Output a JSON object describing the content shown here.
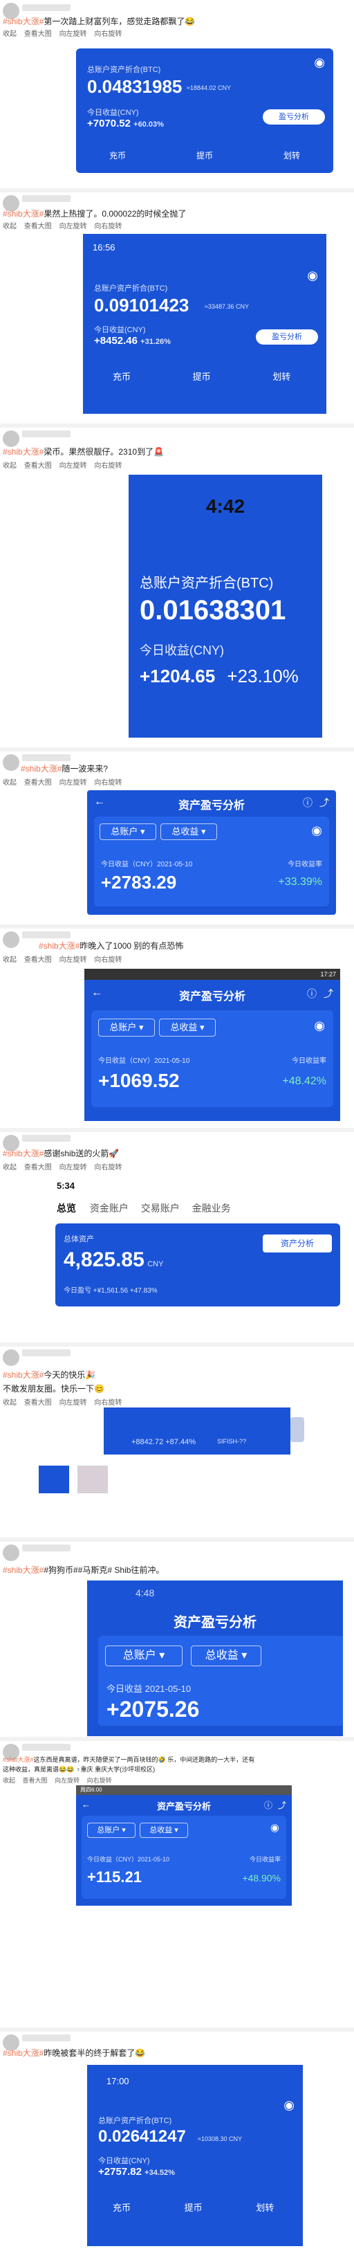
{
  "actions": {
    "favorite": "收起",
    "view_large": "查看大图",
    "rotate_left": "向左旋转",
    "rotate_right": "向右旋转"
  },
  "posts": [
    {
      "caption_tag": "#shib大涨#",
      "caption": "第一次踏上财富列车，感觉走路都飘了😂",
      "app": {
        "label": "总账户资产折合(BTC)",
        "value": "0.04831985",
        "sub": "≈18844.02 CNY",
        "income_label": "今日收益(CNY)",
        "income": "+7070.52",
        "pct": "+60.03%",
        "btn_profit": "盈亏分析",
        "b1": "充币",
        "b2": "提币",
        "b3": "划转"
      }
    },
    {
      "caption_tag": "#shib大涨#",
      "caption": "果然上热搜了。0.000022的时候全抛了",
      "app": {
        "time": "16:56",
        "label": "总账户资产折合(BTC)",
        "value": "0.09101423",
        "sub": "≈33487.36 CNY",
        "income_label": "今日收益(CNY)",
        "income": "+8452.46",
        "pct": "+31.26%",
        "btn_profit": "盈亏分析",
        "b1": "充币",
        "b2": "提币",
        "b3": "划转"
      }
    },
    {
      "caption_tag": "#shib大涨#",
      "caption": "梁币。果然很靓仔。2310到了🚨",
      "app": {
        "time": "4:42",
        "label": "总账户资产折合(BTC)",
        "value": "0.01638301",
        "income_label": "今日收益(CNY)",
        "income": "+1204.65",
        "pct": "+23.10%"
      }
    },
    {
      "caption_tag": "#shib大涨#",
      "caption": "随一波来来?",
      "app": {
        "title": "资产盈亏分析",
        "dd1": "总账户",
        "dd2": "总收益",
        "income_label": "今日收益（CNY）2021-05-10",
        "income": "+2783.29",
        "rate_label": "今日收益率",
        "pct": "+33.39%"
      }
    },
    {
      "caption_tag": "#shib大涨#",
      "caption": "昨晚入了1000 别的有点恐怖",
      "app": {
        "time": "17:27",
        "title": "资产盈亏分析",
        "dd1": "总账户",
        "dd2": "总收益",
        "income_label": "今日收益（CNY）2021-05-10",
        "income": "+1069.52",
        "rate_label": "今日收益率",
        "pct": "+48.42%"
      }
    },
    {
      "caption_tag": "#shib大涨#",
      "caption": "感谢shib送的火箭🚀",
      "app": {
        "time": "5:34",
        "tab1": "总览",
        "tab2": "资金账户",
        "tab3": "交易账户",
        "tab4": "金融业务",
        "label": "总体资产",
        "value": "4,825.85",
        "unit": "CNY",
        "btn": "资产分析",
        "income": "今日盈亏 +¥1,561.56 +47.83%"
      }
    },
    {
      "caption_tag": "#shib大涨#",
      "caption": "今天的快乐🎉",
      "caption2": "不敢发朋友圈。快乐一下😊",
      "app": {
        "income": "+8842.72",
        "pct": "+87.44%",
        "ticker": "SIFISH-??"
      }
    },
    {
      "caption_tag": "#shib大涨#",
      "caption": "#狗狗币##马斯克# Shib往前冲。",
      "app": {
        "time": "4:48",
        "title": "资产盈亏分析",
        "dd1": "总账户",
        "dd2": "总收益",
        "income_label": "今日收益 2021-05-10",
        "income": "+2075.26"
      }
    },
    {
      "caption_tag": "#shib大涨#",
      "caption": "这东西是真离谱，昨天随便买了一两百块钱的🤣 乐，中间还跑路的一大半，还有",
      "caption2": "这种收益，真是离谱😂😂 ♀重庆 重庆大学(沙坪坝校区)",
      "app": {
        "time": "周四6:00",
        "title": "资产盈亏分析",
        "dd1": "总账户",
        "dd2": "总收益",
        "income_label": "今日收益（CNY）2021-05-10",
        "income": "+115.21",
        "rate_label": "今日收益率",
        "pct": "+48.90%"
      }
    },
    {
      "caption_tag": "#shib大涨#",
      "caption": "昨晚被套半的终于解套了😂",
      "app": {
        "time": "17:00",
        "label": "总账户资产折合(BTC)",
        "value": "0.02641247",
        "sub": "≈10308.30 CNY",
        "income_label": "今日收益(CNY)",
        "income": "+2757.82",
        "pct": "+34.52%",
        "b1": "充币",
        "b2": "提币",
        "b3": "划转"
      }
    }
  ]
}
